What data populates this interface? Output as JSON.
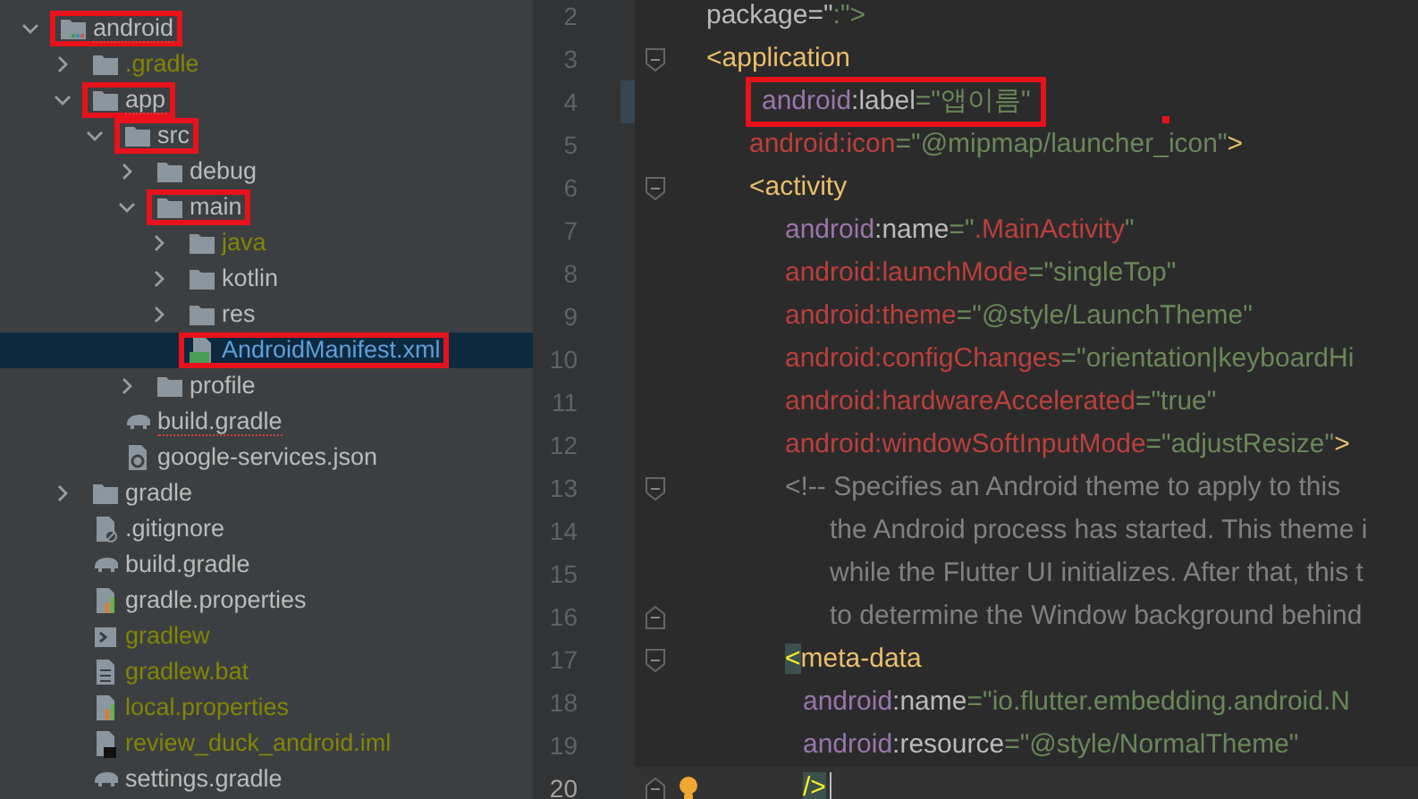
{
  "project_tree": {
    "items": [
      {
        "name": "android",
        "kind": "module",
        "expanded": true,
        "highlighted": true,
        "selected": false,
        "squiggle": true,
        "ignored": false,
        "children": [
          {
            "name": ".gradle",
            "kind": "folder",
            "expanded": false,
            "highlighted": false,
            "selected": false,
            "squiggle": false,
            "ignored": true
          },
          {
            "name": "app",
            "kind": "folder",
            "expanded": true,
            "highlighted": true,
            "selected": false,
            "squiggle": true,
            "ignored": false,
            "children": [
              {
                "name": "src",
                "kind": "folder",
                "expanded": true,
                "highlighted": true,
                "selected": false,
                "squiggle": false,
                "ignored": false,
                "children": [
                  {
                    "name": "debug",
                    "kind": "folder",
                    "expanded": false,
                    "highlighted": false,
                    "selected": false,
                    "squiggle": false,
                    "ignored": false
                  },
                  {
                    "name": "main",
                    "kind": "folder",
                    "expanded": true,
                    "highlighted": true,
                    "selected": false,
                    "squiggle": false,
                    "ignored": false,
                    "children": [
                      {
                        "name": "java",
                        "kind": "folder",
                        "expanded": false,
                        "highlighted": false,
                        "selected": false,
                        "squiggle": false,
                        "ignored": true
                      },
                      {
                        "name": "kotlin",
                        "kind": "folder",
                        "expanded": false,
                        "highlighted": false,
                        "selected": false,
                        "squiggle": false,
                        "ignored": false
                      },
                      {
                        "name": "res",
                        "kind": "folder",
                        "expanded": false,
                        "highlighted": false,
                        "selected": false,
                        "squiggle": false,
                        "ignored": false
                      },
                      {
                        "name": "AndroidManifest.xml",
                        "kind": "manifest",
                        "highlighted": true,
                        "selected": true,
                        "squiggle": false,
                        "ignored": false
                      }
                    ]
                  },
                  {
                    "name": "profile",
                    "kind": "folder",
                    "expanded": false,
                    "highlighted": false,
                    "selected": false,
                    "squiggle": false,
                    "ignored": false
                  }
                ]
              },
              {
                "name": "build.gradle",
                "kind": "gradle",
                "highlighted": false,
                "selected": false,
                "squiggle": true,
                "ignored": false
              },
              {
                "name": "google-services.json",
                "kind": "json",
                "highlighted": false,
                "selected": false,
                "squiggle": false,
                "ignored": false
              }
            ]
          },
          {
            "name": "gradle",
            "kind": "folder",
            "expanded": false,
            "highlighted": false,
            "selected": false,
            "squiggle": false,
            "ignored": false
          },
          {
            "name": ".gitignore",
            "kind": "gitignore",
            "highlighted": false,
            "selected": false,
            "squiggle": false,
            "ignored": false
          },
          {
            "name": "build.gradle",
            "kind": "gradle",
            "highlighted": false,
            "selected": false,
            "squiggle": false,
            "ignored": false
          },
          {
            "name": "gradle.properties",
            "kind": "properties",
            "highlighted": false,
            "selected": false,
            "squiggle": false,
            "ignored": false
          },
          {
            "name": "gradlew",
            "kind": "shell",
            "highlighted": false,
            "selected": false,
            "squiggle": false,
            "ignored": true
          },
          {
            "name": "gradlew.bat",
            "kind": "text",
            "highlighted": false,
            "selected": false,
            "squiggle": false,
            "ignored": true
          },
          {
            "name": "local.properties",
            "kind": "properties",
            "highlighted": false,
            "selected": false,
            "squiggle": false,
            "ignored": true
          },
          {
            "name": "review_duck_android.iml",
            "kind": "iml",
            "highlighted": false,
            "selected": false,
            "squiggle": false,
            "ignored": true
          },
          {
            "name": "settings.gradle",
            "kind": "gradle",
            "highlighted": false,
            "selected": false,
            "squiggle": false,
            "ignored": false
          }
        ]
      }
    ]
  },
  "editor": {
    "lines": [
      {
        "number": "2",
        "fold_start": false,
        "fold_end": false,
        "changed": false,
        "current": false,
        "highlighted": false,
        "bulb": false,
        "tokens": [
          {
            "text": "package=\"",
            "kind": "plain"
          },
          {
            "text": ":\">",
            "kind": "string"
          }
        ]
      },
      {
        "number": "3",
        "fold_start": true,
        "fold_end": false,
        "changed": false,
        "current": false,
        "highlighted": false,
        "bulb": false,
        "tokens": [
          {
            "text": "<application",
            "kind": "tag"
          }
        ],
        "children": [
          {
            "number": "4",
            "fold_start": false,
            "fold_end": false,
            "changed": true,
            "current": false,
            "highlighted": true,
            "bulb": false,
            "tokens": [
              {
                "text": "android",
                "kind": "ns"
              },
              {
                "text": ":label",
                "kind": "plain"
              },
              {
                "text": "=\"앱이름\"",
                "kind": "string"
              }
            ]
          },
          {
            "number": "5",
            "fold_start": false,
            "fold_end": false,
            "changed": false,
            "current": false,
            "highlighted": false,
            "bulb": false,
            "tokens": [
              {
                "text": "android:icon",
                "kind": "error"
              },
              {
                "text": "=\"@mipmap/launcher_icon\"",
                "kind": "string"
              },
              {
                "text": ">",
                "kind": "tag"
              }
            ]
          },
          {
            "number": "6",
            "fold_start": true,
            "fold_end": false,
            "changed": false,
            "current": false,
            "highlighted": false,
            "bulb": false,
            "tokens": [
              {
                "text": "<activity",
                "kind": "tag"
              }
            ],
            "children": [
              {
                "number": "7",
                "fold_start": false,
                "fold_end": false,
                "changed": false,
                "current": false,
                "highlighted": false,
                "bulb": false,
                "tokens": [
                  {
                    "text": "android",
                    "kind": "ns"
                  },
                  {
                    "text": ":name",
                    "kind": "plain"
                  },
                  {
                    "text": "=\"",
                    "kind": "string"
                  },
                  {
                    "text": ".MainActivity",
                    "kind": "error"
                  },
                  {
                    "text": "\"",
                    "kind": "string"
                  }
                ]
              },
              {
                "number": "8",
                "fold_start": false,
                "fold_end": false,
                "changed": false,
                "current": false,
                "highlighted": false,
                "bulb": false,
                "tokens": [
                  {
                    "text": "android:launchMode",
                    "kind": "error"
                  },
                  {
                    "text": "=\"singleTop\"",
                    "kind": "string"
                  }
                ]
              },
              {
                "number": "9",
                "fold_start": false,
                "fold_end": false,
                "changed": false,
                "current": false,
                "highlighted": false,
                "bulb": false,
                "tokens": [
                  {
                    "text": "android:theme",
                    "kind": "error"
                  },
                  {
                    "text": "=\"@style/LaunchTheme\"",
                    "kind": "string"
                  }
                ]
              },
              {
                "number": "10",
                "fold_start": false,
                "fold_end": false,
                "changed": false,
                "current": false,
                "highlighted": false,
                "bulb": false,
                "tokens": [
                  {
                    "text": "android:configChanges",
                    "kind": "error"
                  },
                  {
                    "text": "=\"orientation|keyboardHi",
                    "kind": "string"
                  }
                ]
              },
              {
                "number": "11",
                "fold_start": false,
                "fold_end": false,
                "changed": false,
                "current": false,
                "highlighted": false,
                "bulb": false,
                "tokens": [
                  {
                    "text": "android:hardwareAccelerated",
                    "kind": "error"
                  },
                  {
                    "text": "=\"true\"",
                    "kind": "string"
                  }
                ]
              },
              {
                "number": "12",
                "fold_start": false,
                "fold_end": false,
                "changed": false,
                "current": false,
                "highlighted": false,
                "bulb": false,
                "tokens": [
                  {
                    "text": "android:windowSoftInputMode",
                    "kind": "error"
                  },
                  {
                    "text": "=\"adjustResize\"",
                    "kind": "string"
                  },
                  {
                    "text": ">",
                    "kind": "tag"
                  }
                ]
              },
              {
                "number": "13",
                "fold_start": true,
                "fold_end": false,
                "changed": false,
                "current": false,
                "highlighted": false,
                "bulb": false,
                "tokens": [
                  {
                    "text": "<!-- Specifies an Android theme to apply to this",
                    "kind": "comment"
                  }
                ],
                "children": [
                  {
                    "number": "14",
                    "fold_start": false,
                    "fold_end": false,
                    "changed": false,
                    "current": false,
                    "highlighted": false,
                    "bulb": false,
                    "tokens": [
                      {
                        "text": "the Android process has started. This theme i",
                        "kind": "comment"
                      }
                    ]
                  },
                  {
                    "number": "15",
                    "fold_start": false,
                    "fold_end": false,
                    "changed": false,
                    "current": false,
                    "highlighted": false,
                    "bulb": false,
                    "tokens": [
                      {
                        "text": "while the Flutter UI initializes. After that, this t",
                        "kind": "comment"
                      }
                    ]
                  },
                  {
                    "number": "16",
                    "fold_start": false,
                    "fold_end": true,
                    "changed": false,
                    "current": false,
                    "highlighted": false,
                    "bulb": false,
                    "tokens": [
                      {
                        "text": "to determine the Window background behind",
                        "kind": "comment"
                      }
                    ]
                  }
                ]
              },
              {
                "number": "17",
                "fold_start": true,
                "fold_end": false,
                "changed": false,
                "current": false,
                "highlighted": false,
                "bulb": false,
                "tokens": [
                  {
                    "text": "<",
                    "kind": "match"
                  },
                  {
                    "text": "meta-data",
                    "kind": "tag"
                  }
                ],
                "children": [
                  {
                    "number": "18",
                    "fold_start": false,
                    "fold_end": false,
                    "changed": false,
                    "current": false,
                    "highlighted": false,
                    "bulb": false,
                    "tokens": [
                      {
                        "text": "android",
                        "kind": "ns"
                      },
                      {
                        "text": ":name",
                        "kind": "plain"
                      },
                      {
                        "text": "=\"io.flutter.embedding.android.N",
                        "kind": "string"
                      }
                    ]
                  },
                  {
                    "number": "19",
                    "fold_start": false,
                    "fold_end": false,
                    "changed": false,
                    "current": false,
                    "highlighted": false,
                    "bulb": false,
                    "tokens": [
                      {
                        "text": "android",
                        "kind": "ns"
                      },
                      {
                        "text": ":resource",
                        "kind": "plain"
                      },
                      {
                        "text": "=\"@style/NormalTheme\"",
                        "kind": "string"
                      }
                    ]
                  },
                  {
                    "number": "20",
                    "fold_start": false,
                    "fold_end": true,
                    "changed": false,
                    "current": true,
                    "highlighted": false,
                    "bulb": true,
                    "tokens": [
                      {
                        "text": "/>",
                        "kind": "match"
                      }
                    ]
                  }
                ]
              }
            ]
          }
        ]
      }
    ]
  }
}
